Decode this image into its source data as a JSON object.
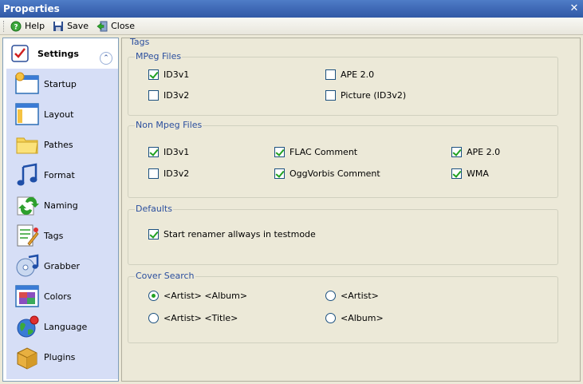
{
  "window": {
    "title": "Properties"
  },
  "toolbar": {
    "help": "Help",
    "save": "Save",
    "close": "Close"
  },
  "sidebar": {
    "header": "Settings",
    "items": [
      {
        "label": "Startup",
        "icon": "startup-icon"
      },
      {
        "label": "Layout",
        "icon": "layout-icon"
      },
      {
        "label": "Pathes",
        "icon": "folder-icon"
      },
      {
        "label": "Format",
        "icon": "music-note-icon"
      },
      {
        "label": "Naming",
        "icon": "naming-arrows-icon"
      },
      {
        "label": "Tags",
        "icon": "tag-edit-icon"
      },
      {
        "label": "Grabber",
        "icon": "cd-grabber-icon"
      },
      {
        "label": "Colors",
        "icon": "color-palette-icon"
      },
      {
        "label": "Language",
        "icon": "globe-icon"
      },
      {
        "label": "Plugins",
        "icon": "package-icon"
      }
    ]
  },
  "content": {
    "section_title": "Tags",
    "mpeg": {
      "title": "MPeg Files",
      "id3v1": {
        "label": "ID3v1",
        "checked": true
      },
      "id3v2": {
        "label": "ID3v2",
        "checked": false
      },
      "ape2": {
        "label": "APE 2.0",
        "checked": false
      },
      "picture": {
        "label": "Picture (ID3v2)",
        "checked": false
      }
    },
    "nonmpeg": {
      "title": "Non Mpeg Files",
      "id3v1": {
        "label": "ID3v1",
        "checked": true
      },
      "id3v2": {
        "label": "ID3v2",
        "checked": false
      },
      "flac": {
        "label": "FLAC Comment",
        "checked": true
      },
      "ogg": {
        "label": "OggVorbis Comment",
        "checked": true
      },
      "ape2": {
        "label": "APE 2.0",
        "checked": true
      },
      "wma": {
        "label": "WMA",
        "checked": true
      }
    },
    "defaults": {
      "title": "Defaults",
      "testmode": {
        "label": "Start renamer allways in testmode",
        "checked": true
      }
    },
    "cover": {
      "title": "Cover Search",
      "artist_album": {
        "label": "<Artist> <Album>",
        "selected": true
      },
      "artist_title": {
        "label": "<Artist> <Title>",
        "selected": false
      },
      "artist": {
        "label": "<Artist>",
        "selected": false
      },
      "album": {
        "label": "<Album>",
        "selected": false
      }
    }
  },
  "colors": {
    "titlebar": "#315AA6",
    "accent": "#2B4F9E",
    "check": "#21A121",
    "sidebar_bg": "#D6DEF6"
  }
}
